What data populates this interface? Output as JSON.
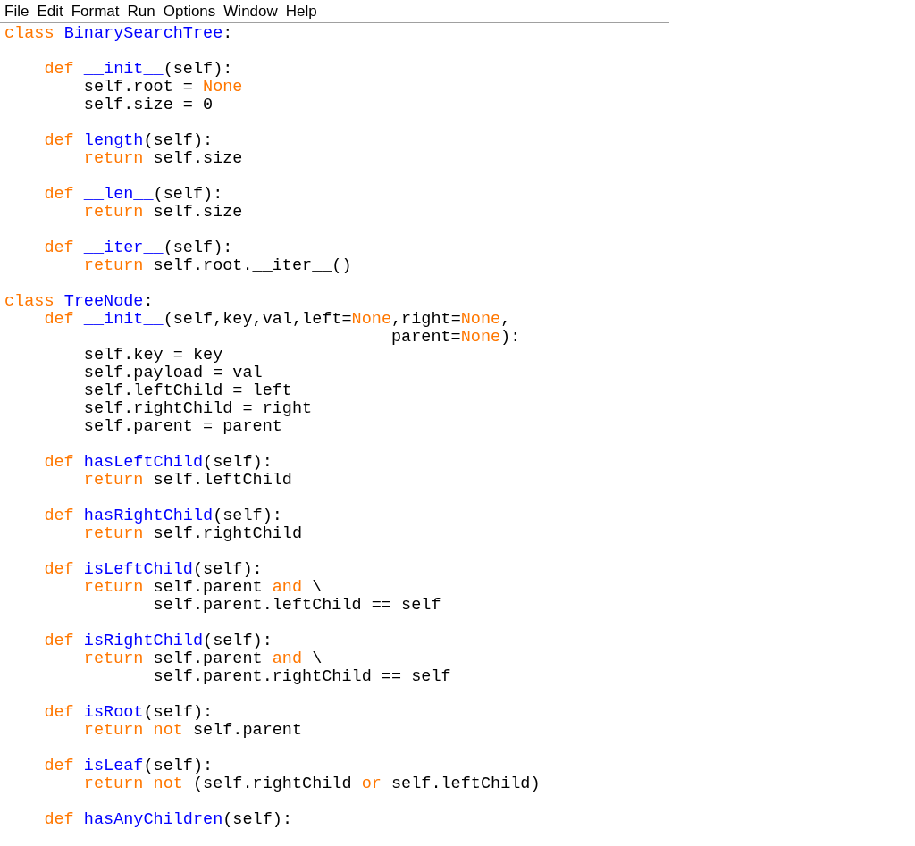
{
  "menu": [
    "File",
    "Edit",
    "Format",
    "Run",
    "Options",
    "Window",
    "Help"
  ],
  "editor": {
    "lines": [
      {
        "kind": "code",
        "tokens": [
          {
            "kind": "keyword",
            "text": "class "
          },
          {
            "kind": "definition",
            "text": "BinarySearchTree"
          },
          {
            "kind": "plain",
            "text": ":"
          }
        ]
      },
      {
        "kind": "blank"
      },
      {
        "kind": "code",
        "tokens": [
          {
            "kind": "keyword",
            "text": "    def "
          },
          {
            "kind": "definition",
            "text": "__init__"
          },
          {
            "kind": "plain",
            "text": "(self):"
          }
        ]
      },
      {
        "kind": "code",
        "tokens": [
          {
            "kind": "plain",
            "text": "        self.root = "
          },
          {
            "kind": "keyword",
            "text": "None"
          }
        ]
      },
      {
        "kind": "code",
        "tokens": [
          {
            "kind": "plain",
            "text": "        self.size = 0"
          }
        ]
      },
      {
        "kind": "blank"
      },
      {
        "kind": "code",
        "tokens": [
          {
            "kind": "keyword",
            "text": "    def "
          },
          {
            "kind": "definition",
            "text": "length"
          },
          {
            "kind": "plain",
            "text": "(self):"
          }
        ]
      },
      {
        "kind": "code",
        "tokens": [
          {
            "kind": "keyword",
            "text": "        return"
          },
          {
            "kind": "plain",
            "text": " self.size"
          }
        ]
      },
      {
        "kind": "blank"
      },
      {
        "kind": "code",
        "tokens": [
          {
            "kind": "keyword",
            "text": "    def "
          },
          {
            "kind": "definition",
            "text": "__len__"
          },
          {
            "kind": "plain",
            "text": "(self):"
          }
        ]
      },
      {
        "kind": "code",
        "tokens": [
          {
            "kind": "keyword",
            "text": "        return"
          },
          {
            "kind": "plain",
            "text": " self.size"
          }
        ]
      },
      {
        "kind": "blank"
      },
      {
        "kind": "code",
        "tokens": [
          {
            "kind": "keyword",
            "text": "    def "
          },
          {
            "kind": "definition",
            "text": "__iter__"
          },
          {
            "kind": "plain",
            "text": "(self):"
          }
        ]
      },
      {
        "kind": "code",
        "tokens": [
          {
            "kind": "keyword",
            "text": "        return"
          },
          {
            "kind": "plain",
            "text": " self.root.__iter__()"
          }
        ]
      },
      {
        "kind": "blank"
      },
      {
        "kind": "code",
        "tokens": [
          {
            "kind": "keyword",
            "text": "class "
          },
          {
            "kind": "definition",
            "text": "TreeNode"
          },
          {
            "kind": "plain",
            "text": ":"
          }
        ]
      },
      {
        "kind": "code",
        "tokens": [
          {
            "kind": "keyword",
            "text": "    def "
          },
          {
            "kind": "definition",
            "text": "__init__"
          },
          {
            "kind": "plain",
            "text": "(self,key,val,left="
          },
          {
            "kind": "keyword",
            "text": "None"
          },
          {
            "kind": "plain",
            "text": ",right="
          },
          {
            "kind": "keyword",
            "text": "None"
          },
          {
            "kind": "plain",
            "text": ","
          }
        ]
      },
      {
        "kind": "code",
        "tokens": [
          {
            "kind": "plain",
            "text": "                                       parent="
          },
          {
            "kind": "keyword",
            "text": "None"
          },
          {
            "kind": "plain",
            "text": "):"
          }
        ]
      },
      {
        "kind": "code",
        "tokens": [
          {
            "kind": "plain",
            "text": "        self.key = key"
          }
        ]
      },
      {
        "kind": "code",
        "tokens": [
          {
            "kind": "plain",
            "text": "        self.payload = val"
          }
        ]
      },
      {
        "kind": "code",
        "tokens": [
          {
            "kind": "plain",
            "text": "        self.leftChild = left"
          }
        ]
      },
      {
        "kind": "code",
        "tokens": [
          {
            "kind": "plain",
            "text": "        self.rightChild = right"
          }
        ]
      },
      {
        "kind": "code",
        "tokens": [
          {
            "kind": "plain",
            "text": "        self.parent = parent"
          }
        ]
      },
      {
        "kind": "blank"
      },
      {
        "kind": "code",
        "tokens": [
          {
            "kind": "keyword",
            "text": "    def "
          },
          {
            "kind": "definition",
            "text": "hasLeftChild"
          },
          {
            "kind": "plain",
            "text": "(self):"
          }
        ]
      },
      {
        "kind": "code",
        "tokens": [
          {
            "kind": "keyword",
            "text": "        return"
          },
          {
            "kind": "plain",
            "text": " self.leftChild"
          }
        ]
      },
      {
        "kind": "blank"
      },
      {
        "kind": "code",
        "tokens": [
          {
            "kind": "keyword",
            "text": "    def "
          },
          {
            "kind": "definition",
            "text": "hasRightChild"
          },
          {
            "kind": "plain",
            "text": "(self):"
          }
        ]
      },
      {
        "kind": "code",
        "tokens": [
          {
            "kind": "keyword",
            "text": "        return"
          },
          {
            "kind": "plain",
            "text": " self.rightChild"
          }
        ]
      },
      {
        "kind": "blank"
      },
      {
        "kind": "code",
        "tokens": [
          {
            "kind": "keyword",
            "text": "    def "
          },
          {
            "kind": "definition",
            "text": "isLeftChild"
          },
          {
            "kind": "plain",
            "text": "(self):"
          }
        ]
      },
      {
        "kind": "code",
        "tokens": [
          {
            "kind": "keyword",
            "text": "        return"
          },
          {
            "kind": "plain",
            "text": " self.parent "
          },
          {
            "kind": "keyword",
            "text": "and"
          },
          {
            "kind": "plain",
            "text": " \\"
          }
        ]
      },
      {
        "kind": "code",
        "tokens": [
          {
            "kind": "plain",
            "text": "               self.parent.leftChild == self"
          }
        ]
      },
      {
        "kind": "blank"
      },
      {
        "kind": "code",
        "tokens": [
          {
            "kind": "keyword",
            "text": "    def "
          },
          {
            "kind": "definition",
            "text": "isRightChild"
          },
          {
            "kind": "plain",
            "text": "(self):"
          }
        ]
      },
      {
        "kind": "code",
        "tokens": [
          {
            "kind": "keyword",
            "text": "        return"
          },
          {
            "kind": "plain",
            "text": " self.parent "
          },
          {
            "kind": "keyword",
            "text": "and"
          },
          {
            "kind": "plain",
            "text": " \\"
          }
        ]
      },
      {
        "kind": "code",
        "tokens": [
          {
            "kind": "plain",
            "text": "               self.parent.rightChild == self"
          }
        ]
      },
      {
        "kind": "blank"
      },
      {
        "kind": "code",
        "tokens": [
          {
            "kind": "keyword",
            "text": "    def "
          },
          {
            "kind": "definition",
            "text": "isRoot"
          },
          {
            "kind": "plain",
            "text": "(self):"
          }
        ]
      },
      {
        "kind": "code",
        "tokens": [
          {
            "kind": "keyword",
            "text": "        return not"
          },
          {
            "kind": "plain",
            "text": " self.parent"
          }
        ]
      },
      {
        "kind": "blank"
      },
      {
        "kind": "code",
        "tokens": [
          {
            "kind": "keyword",
            "text": "    def "
          },
          {
            "kind": "definition",
            "text": "isLeaf"
          },
          {
            "kind": "plain",
            "text": "(self):"
          }
        ]
      },
      {
        "kind": "code",
        "tokens": [
          {
            "kind": "keyword",
            "text": "        return not"
          },
          {
            "kind": "plain",
            "text": " (self.rightChild "
          },
          {
            "kind": "keyword",
            "text": "or"
          },
          {
            "kind": "plain",
            "text": " self.leftChild)"
          }
        ]
      },
      {
        "kind": "blank"
      },
      {
        "kind": "code",
        "tokens": [
          {
            "kind": "keyword",
            "text": "    def "
          },
          {
            "kind": "definition",
            "text": "hasAnyChildren"
          },
          {
            "kind": "plain",
            "text": "(self):"
          }
        ]
      }
    ]
  }
}
